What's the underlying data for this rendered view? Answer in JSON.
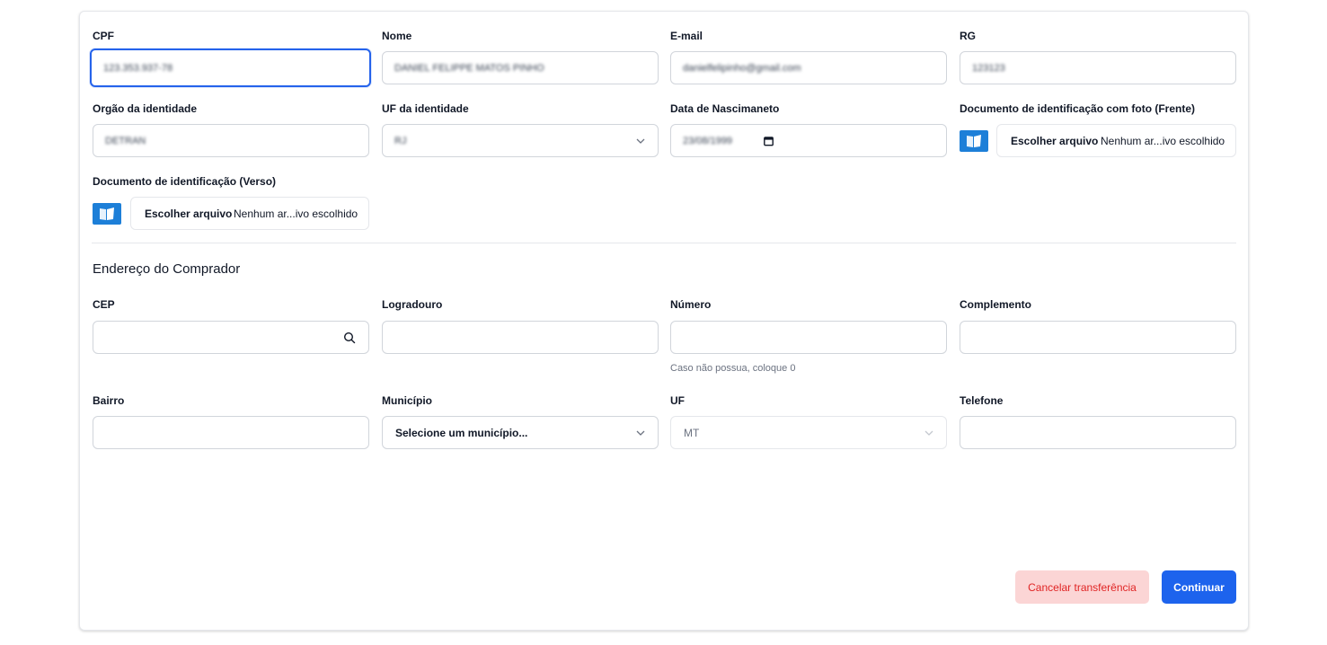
{
  "labels": {
    "cpf": "CPF",
    "nome": "Nome",
    "email": "E-mail",
    "rg": "RG",
    "orgao": "Orgão da identidade",
    "uf_identidade": "UF da identidade",
    "data_nascimento": "Data de Nascimaneto",
    "doc_frente": "Documento de identificação com foto (Frente)",
    "doc_verso": "Documento de identificação (Verso)"
  },
  "values": {
    "cpf": "123.353.937-78",
    "nome": "DANIEL FELIPPE MATOS PINHO",
    "email": "danielfelipinho@gmail.com",
    "rg": "123123",
    "orgao": "DETRAN",
    "uf_identidade": "RJ",
    "data_nascimento": "23/08/1999"
  },
  "file_inputs": {
    "button_label": "Escolher arquivo",
    "no_file_text": "Nenhum ar...ivo escolhido"
  },
  "address": {
    "section_title": "Endereço do Comprador",
    "labels": {
      "cep": "CEP",
      "logradouro": "Logradouro",
      "numero": "Número",
      "complemento": "Complemento",
      "bairro": "Bairro",
      "municipio": "Município",
      "uf": "UF",
      "telefone": "Telefone"
    },
    "numero_hint": "Caso não possua, coloque 0",
    "municipio_placeholder": "Selecione um município...",
    "uf_value": "MT"
  },
  "actions": {
    "cancel_label": "Cancelar transferência",
    "continue_label": "Continuar"
  },
  "colors": {
    "focus": "#2563eb",
    "primary": "#1d63ed",
    "danger_bg": "#fbd5d5",
    "danger_text": "#e02424"
  },
  "icons": {
    "file": "document-upload-icon",
    "select": "chevron-down-icon",
    "search": "search-icon",
    "date": "calendar-icon"
  }
}
